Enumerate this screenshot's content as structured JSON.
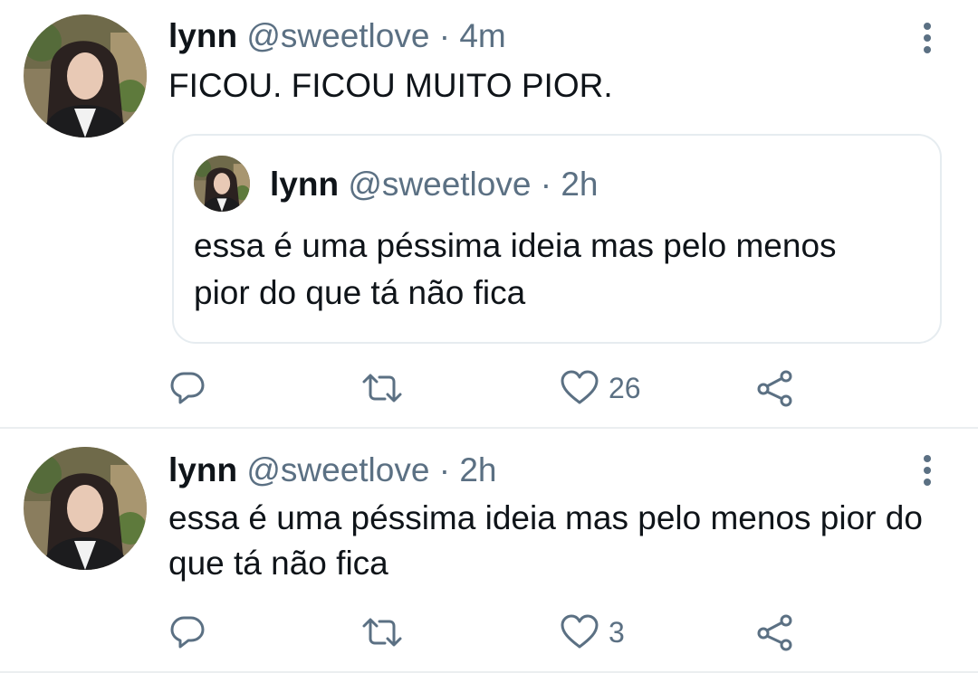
{
  "tweets": [
    {
      "name": "lynn",
      "handle": "@sweetlove",
      "separator": "·",
      "time": "4m",
      "text": "FICOU. FICOU MUITO PIOR.",
      "quoted": {
        "name": "lynn",
        "handle": "@sweetlove",
        "separator": "·",
        "time": "2h",
        "text": "essa é uma péssima ideia mas pelo menos pior do que tá não fica"
      },
      "actions": {
        "reply_count": "",
        "retweet_count": "",
        "like_count": "26"
      }
    },
    {
      "name": "lynn",
      "handle": "@sweetlove",
      "separator": "·",
      "time": "2h",
      "text": "essa é uma péssima ideia mas pelo menos pior do que tá não fica",
      "actions": {
        "reply_count": "",
        "retweet_count": "",
        "like_count": "3"
      }
    }
  ],
  "icons": {
    "reply": "reply-icon",
    "retweet": "retweet-icon",
    "like": "heart-icon",
    "share": "share-icon",
    "more": "more-vertical-icon"
  },
  "colors": {
    "text_primary": "#0f1419",
    "text_secondary": "#5b7083",
    "divider": "#ebeef0",
    "quote_border": "#e6ecf0"
  }
}
